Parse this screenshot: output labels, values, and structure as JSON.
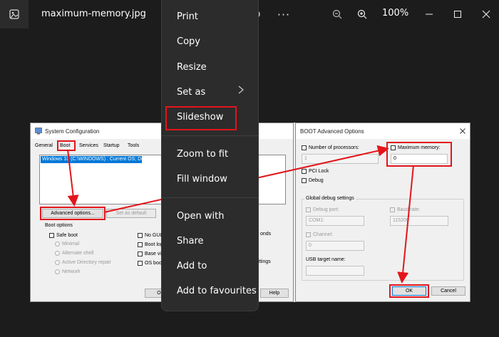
{
  "viewer": {
    "file_name": "maximum-memory.jpg",
    "zoom": "100%"
  },
  "context_menu": {
    "items": [
      {
        "label": "Print"
      },
      {
        "label": "Copy"
      },
      {
        "label": "Resize"
      },
      {
        "label": "Set as"
      },
      {
        "label": "Slideshow"
      },
      {
        "label": "Zoom to fit"
      },
      {
        "label": "Fill window"
      },
      {
        "label": "Open with"
      },
      {
        "label": "Share"
      },
      {
        "label": "Add to"
      },
      {
        "label": "Add to favourites"
      }
    ]
  },
  "sysconfig": {
    "title": "System Configuration",
    "tabs": [
      "General",
      "Boot",
      "Services",
      "Startup",
      "Tools"
    ],
    "os_entry": "Windows 10 (C:\\WINDOWS) : Current OS; Default OS",
    "advanced_button": "Advanced options...",
    "default_button": "Set as default",
    "boot_options_label": "Boot options",
    "safe_boot": "Safe boot",
    "radios": [
      "Minimal",
      "Alternate shell",
      "Active Directory repair",
      "Network"
    ],
    "right_checks": [
      "No GUI",
      "Boot log",
      "Base vid",
      "OS boot"
    ],
    "seconds_fragment": "onds",
    "settings_fragment": "ttings",
    "ok_fragment": "O",
    "help_button": "Help"
  },
  "advanced": {
    "title": "BOOT Advanced Options",
    "num_processors_label": "Number of processors:",
    "num_processors_value": "1",
    "max_memory_label": "Maximum memory:",
    "max_memory_value": "0",
    "pci_lock": "PCI Lock",
    "debug": "Debug",
    "debug_settings_label": "Global debug settings",
    "debug_port_label": "Debug port:",
    "debug_port_value": "COM1:",
    "baud_rate_label": "Baud rate:",
    "baud_rate_value": "115200",
    "channel_label": "Channel:",
    "channel_value": "0",
    "usb_target_label": "USB target name:",
    "ok_button": "OK",
    "cancel_button": "Cancel"
  },
  "colors": {
    "highlight_red": "#e3151a",
    "selection_blue": "#0078d7"
  }
}
